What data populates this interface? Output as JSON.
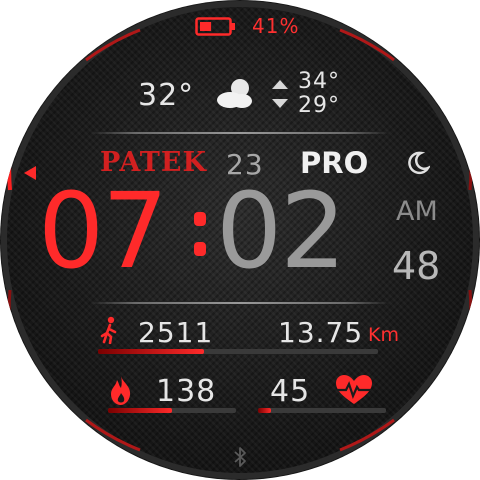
{
  "battery": {
    "percent_text": "41%",
    "level": 0.41
  },
  "weather": {
    "temperature": "32°",
    "high": "34°",
    "low": "29°",
    "icon": "partly-cloudy-icon"
  },
  "brand": {
    "name": "PATEK",
    "day": "23",
    "model": "PRO",
    "moon_icon": "crescent-moon-icon"
  },
  "time": {
    "hours": "07",
    "separator": ":",
    "minutes": "02",
    "ampm": "AM",
    "seconds": "48"
  },
  "steps": {
    "value": "2511",
    "progress": 0.38,
    "icon": "walking-person-icon"
  },
  "distance": {
    "value": "13.75",
    "unit": "Km"
  },
  "calories": {
    "value": "138",
    "progress": 0.5,
    "icon": "flame-icon"
  },
  "heart": {
    "value": "45",
    "progress": 0.1,
    "icon": "heart-pulse-icon"
  },
  "status": {
    "bluetooth_icon": "bluetooth-icon"
  },
  "colors": {
    "accent": "#ff3030",
    "text": "#e6e6e6",
    "digits_gray": "#9a9a9a",
    "background": "#1c1c1c"
  }
}
